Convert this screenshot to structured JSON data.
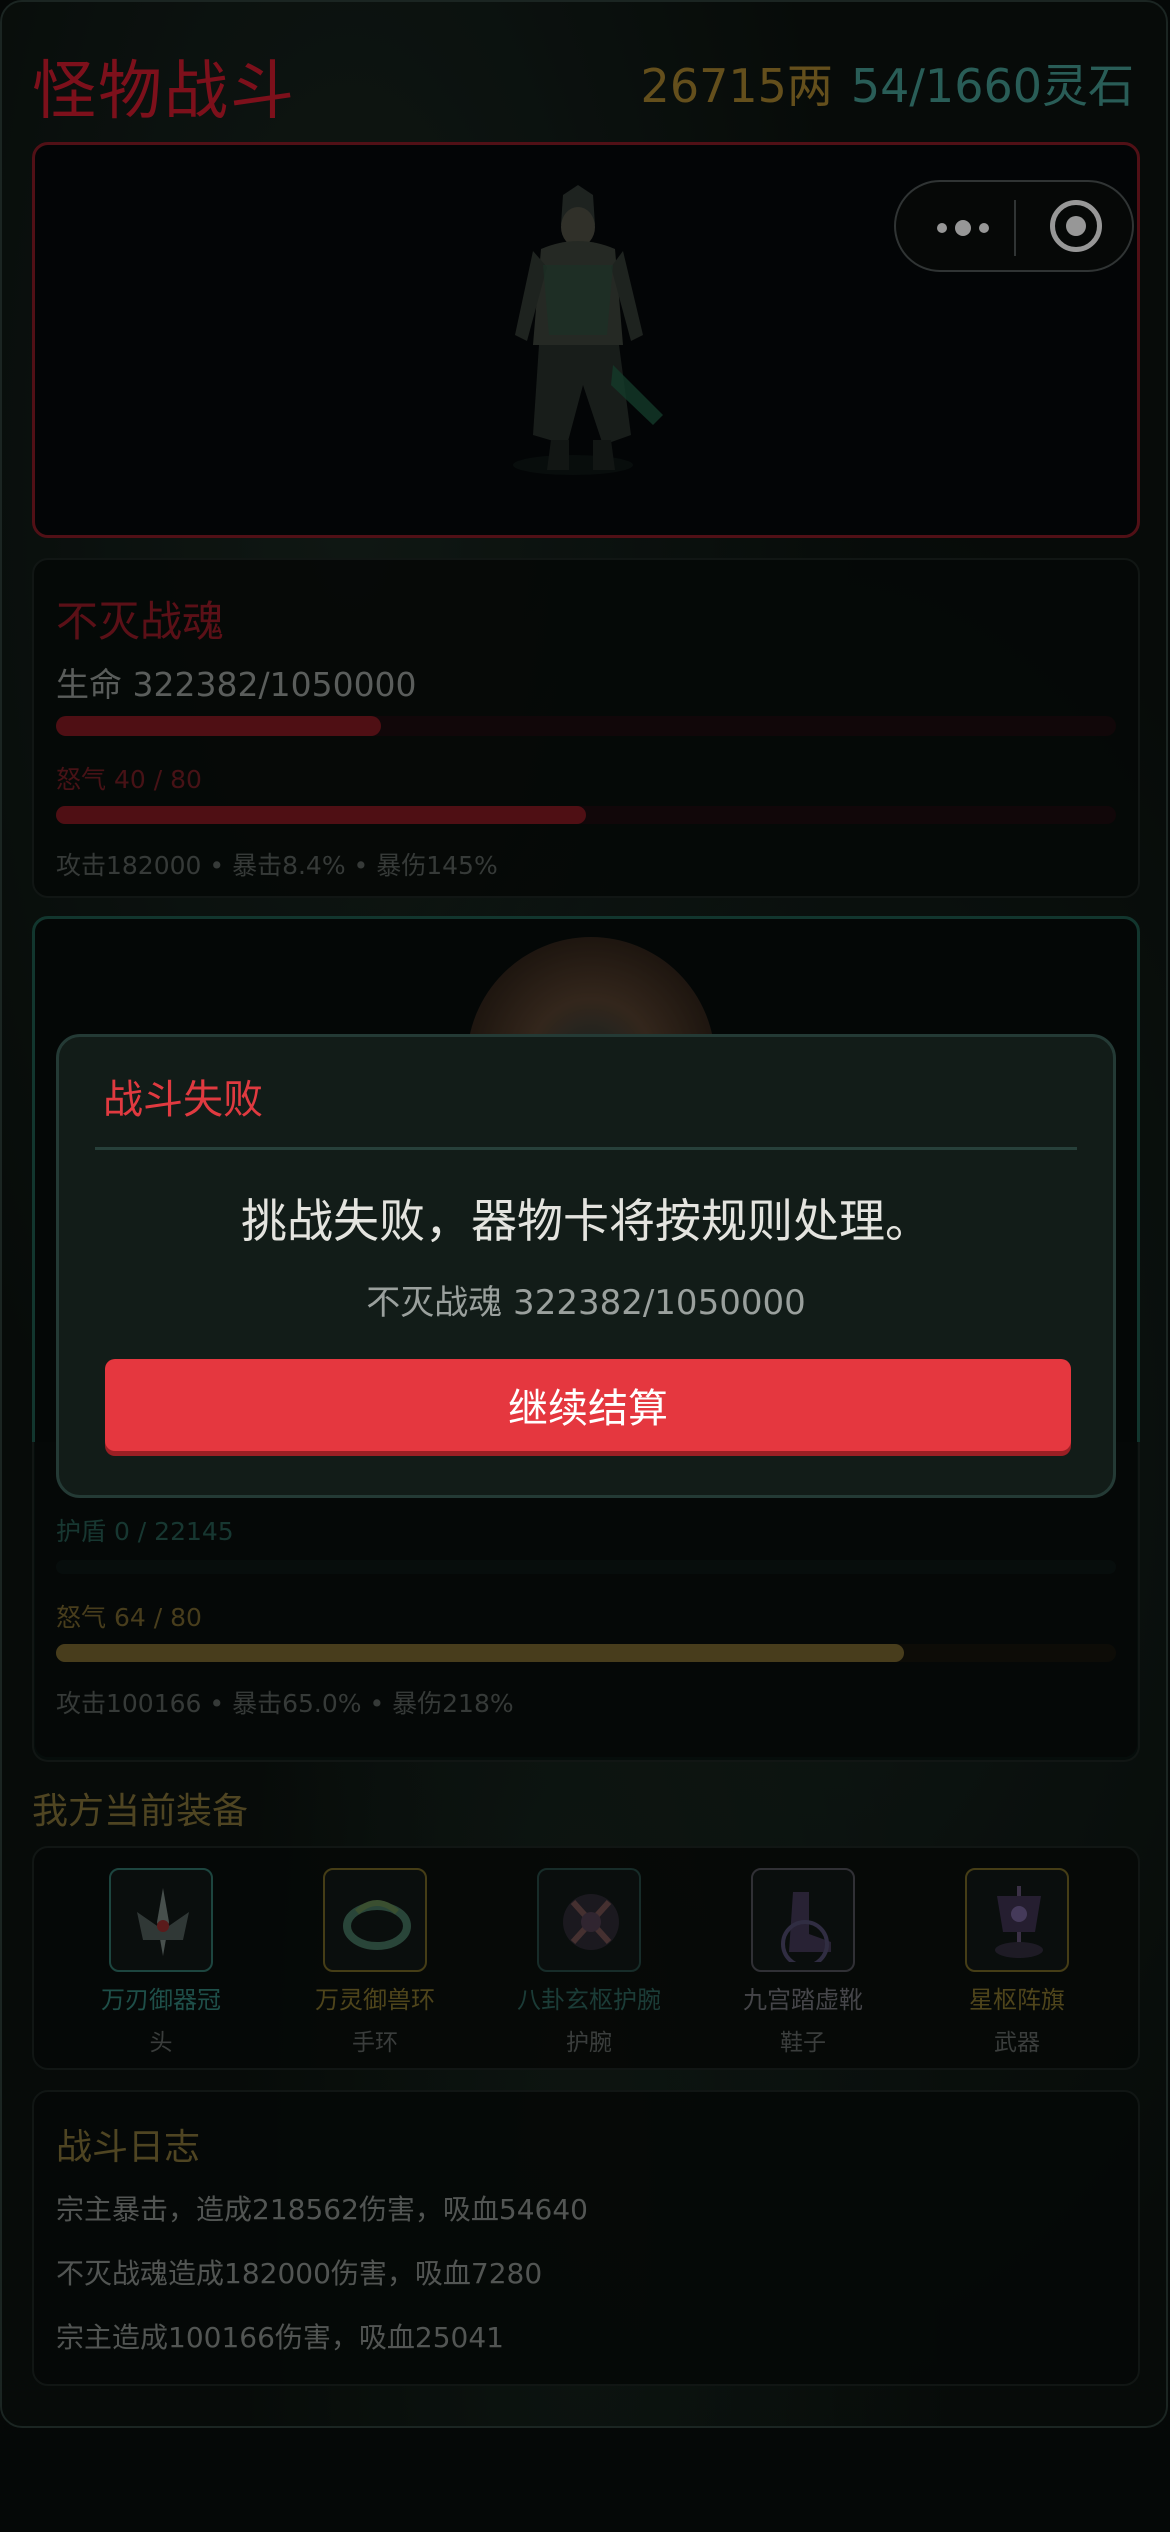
{
  "header": {
    "title": "怪物战斗",
    "gold": "26715两",
    "spirit_stone": "54/1660灵石"
  },
  "enemy": {
    "name": "不灭战魂",
    "hp_text": "生命 322382/1050000",
    "hp_fraction": 0.307,
    "rage_text": "怒气 40 / 80",
    "rage_fraction": 0.5,
    "attrs": "攻击182000 • 暴击8.4% • 暴伤145%"
  },
  "player": {
    "shield_text": "护盾 0 / 22145",
    "shield_fraction": 0,
    "rage_text": "怒气 64 / 80",
    "rage_fraction": 0.8,
    "attrs": "攻击100166 • 暴击65.0% • 暴伤218%"
  },
  "equipment": {
    "title": "我方当前装备",
    "items": [
      {
        "name": "万刃御器冠",
        "slot": "头",
        "color": "#3a8c80",
        "icon": "crown-blades-icon"
      },
      {
        "name": "万灵御兽环",
        "slot": "手环",
        "color": "#8a7a2a",
        "icon": "beast-ring-icon"
      },
      {
        "name": "八卦玄枢护腕",
        "slot": "护腕",
        "color": "#2f6b62",
        "icon": "bagua-bracer-icon"
      },
      {
        "name": "九宫踏虚靴",
        "slot": "鞋子",
        "color": "#6a6a70",
        "icon": "void-boots-icon"
      },
      {
        "name": "星枢阵旗",
        "slot": "武器",
        "color": "#8a7a2a",
        "icon": "star-banner-icon"
      }
    ]
  },
  "log": {
    "title": "战斗日志",
    "lines": [
      "宗主暴击，造成218562伤害，吸血54640",
      "不灭战魂造成182000伤害，吸血7280",
      "宗主造成100166伤害，吸血25041"
    ]
  },
  "modal": {
    "title": "战斗失败",
    "message": "挑战失败，器物卡将按规则处理。",
    "sub": "不灭战魂 322382/1050000",
    "button": "继续结算"
  },
  "colors": {
    "accent_red": "#e5373f",
    "hp_red": "#8d1a24",
    "rage_gold": "#7a6a2c",
    "teal": "#1d5347"
  }
}
